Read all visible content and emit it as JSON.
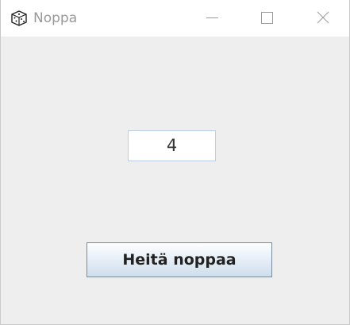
{
  "window": {
    "title": "Noppa",
    "icon": "dice-icon",
    "controls": {
      "minimize": "minimize-icon",
      "maximize": "maximize-icon",
      "close": "close-icon"
    }
  },
  "main": {
    "result_value": "4",
    "roll_button_label": "Heitä noppaa"
  },
  "colors": {
    "background": "#eeeeee",
    "titlebar": "#ffffff",
    "field_border": "#b8cfe5",
    "button_border": "#7a8a99"
  }
}
